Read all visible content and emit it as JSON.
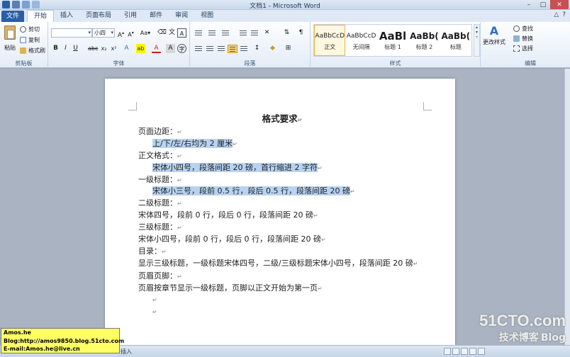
{
  "window": {
    "title": "文档1 - Microsoft Word"
  },
  "tabs": {
    "file": "文件",
    "items": [
      "开始",
      "插入",
      "页面布局",
      "引用",
      "邮件",
      "审阅",
      "视图"
    ],
    "active_index": 0
  },
  "ribbon": {
    "clipboard": {
      "paste": "粘贴",
      "cut": "剪切",
      "copy": "复制",
      "format_painter": "格式刷",
      "label": "剪贴板"
    },
    "font": {
      "font_name": "",
      "font_size": "小四",
      "label": "字体"
    },
    "paragraph": {
      "label": "段落"
    },
    "styles": {
      "items": [
        {
          "sample": "AaBbCcD",
          "name": "正文",
          "selected": true
        },
        {
          "sample": "AaBbCcD",
          "name": "无间隔",
          "selected": false
        },
        {
          "sample": "AaBl",
          "name": "标题 1",
          "selected": false
        },
        {
          "sample": "AaBb(",
          "name": "标题 2",
          "selected": false
        },
        {
          "sample": "AaBb(",
          "name": "标题",
          "selected": false
        }
      ],
      "change_styles": "更改样式",
      "label": "样式"
    },
    "editing": {
      "find": "查找",
      "replace": "替换",
      "select": "选择",
      "label": "编辑"
    }
  },
  "document": {
    "title": "格式要求",
    "lines": [
      {
        "text": "页面边距：",
        "indent": false,
        "highlight": false
      },
      {
        "text": "上/下/左/右均为 2 厘米",
        "indent": true,
        "highlight": true
      },
      {
        "text": "正文格式：",
        "indent": false,
        "highlight": false
      },
      {
        "text": "宋体小四号，段落间距 20 磅，首行缩进 2 字符",
        "indent": true,
        "highlight": true
      },
      {
        "text": "一级标题：",
        "indent": false,
        "highlight": false
      },
      {
        "text": "宋体小三号，段前 0.5 行，段后 0.5 行，段落间距 20 磅",
        "indent": true,
        "highlight": true
      },
      {
        "text": "二级标题：",
        "indent": false,
        "highlight": false
      },
      {
        "text": "宋体四号，段前 0 行，段后 0 行，段落间距 20 磅",
        "indent": false,
        "highlight": false
      },
      {
        "text": "三级标题：",
        "indent": false,
        "highlight": false
      },
      {
        "text": "宋体小四号，段前 0 行，段后 0 行，段落间距 20 磅",
        "indent": false,
        "highlight": false
      },
      {
        "text": "目录：",
        "indent": false,
        "highlight": false
      },
      {
        "text": "显示三级标题，一级标题宋体四号，二级/三级标题宋体小四号，段落间距 20 磅",
        "indent": false,
        "highlight": false,
        "wrap": true
      },
      {
        "text": "页眉页脚：",
        "indent": false,
        "highlight": false
      },
      {
        "text": "页眉按章节显示一级标题，页脚以正文开始为第一页",
        "indent": false,
        "highlight": false
      }
    ],
    "paragraph_mark": "↵"
  },
  "statusbar": {
    "mode": "插入"
  },
  "credit": {
    "line1": "Amos.he",
    "line2": "Blog:http://amos9850.blog.51cto.com",
    "line3": "E-mail:Amos.he@live.cn"
  },
  "watermark": {
    "site": "51CTO.com",
    "tagline": "技术博客",
    "blog": "Blog"
  },
  "colors": {
    "accent": "#2a5ea7",
    "selection": "#b8d3f1",
    "credit_bg": "#ffff66"
  }
}
